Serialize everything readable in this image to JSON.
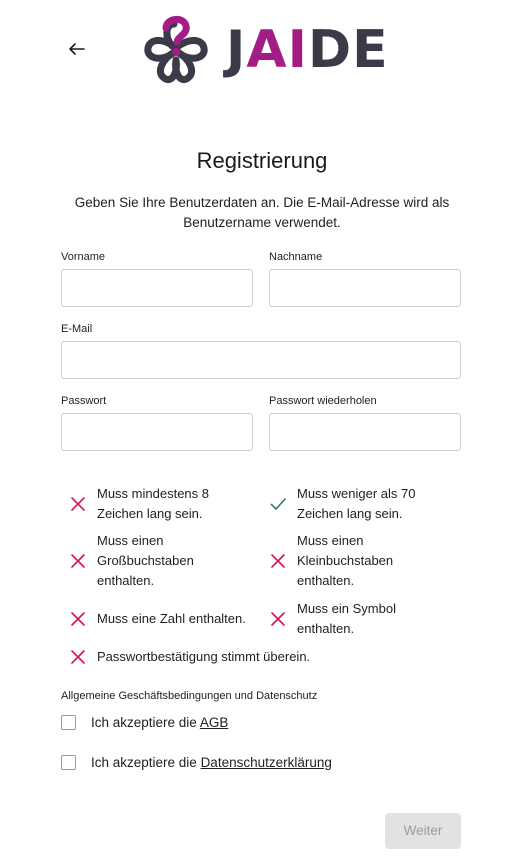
{
  "header": {
    "back_icon": "arrow-left-icon",
    "logo": {
      "prefix": "J",
      "highlight": "AI",
      "suffix": "DE"
    }
  },
  "page": {
    "title": "Registrierung",
    "intro_line1": "Geben Sie Ihre Benutzerdaten an. Die E-Mail-Adresse wird als",
    "intro_line2": "Benutzername verwendet."
  },
  "form": {
    "first_name": {
      "label": "Vorname",
      "value": ""
    },
    "last_name": {
      "label": "Nachname",
      "value": ""
    },
    "email": {
      "label": "E-Mail",
      "value": ""
    },
    "password": {
      "label": "Passwort",
      "value": ""
    },
    "password_repeat": {
      "label": "Passwort wiederholen",
      "value": ""
    }
  },
  "password_rules": [
    {
      "lines": [
        "Muss mindestens 8",
        "Zeichen lang sein."
      ],
      "status": "fail",
      "icon": "x-icon"
    },
    {
      "lines": [
        "Muss weniger als 70",
        "Zeichen lang sein."
      ],
      "status": "pass",
      "icon": "check-icon"
    },
    {
      "lines": [
        "Muss einen",
        "Großbuchstaben",
        "enthalten."
      ],
      "status": "fail",
      "icon": "x-icon"
    },
    {
      "lines": [
        "Muss einen",
        "Kleinbuchstaben",
        "enthalten."
      ],
      "status": "fail",
      "icon": "x-icon"
    },
    {
      "lines": [
        "Muss eine Zahl enthalten."
      ],
      "status": "fail",
      "icon": "x-icon"
    },
    {
      "lines": [
        "Muss ein Symbol",
        "enthalten."
      ],
      "status": "fail",
      "icon": "x-icon"
    },
    {
      "lines": [
        "Passwortbestätigung stimmt überein."
      ],
      "status": "fail",
      "icon": "x-icon"
    }
  ],
  "terms": {
    "section_label": "Allgemeine Geschäftsbedingungen und Datenschutz",
    "agb": {
      "prefix": "Ich akzeptiere die ",
      "link": "AGB",
      "checked": false
    },
    "privacy": {
      "prefix": "Ich akzeptiere die ",
      "link": "Datenschutzerklärung",
      "checked": false
    }
  },
  "actions": {
    "next_label": "Weiter",
    "disabled": true
  },
  "colors": {
    "fail": "#d4145a",
    "pass": "#2e7d5b",
    "brand": "#a21d86",
    "logo_dark": "#3a3a48"
  }
}
